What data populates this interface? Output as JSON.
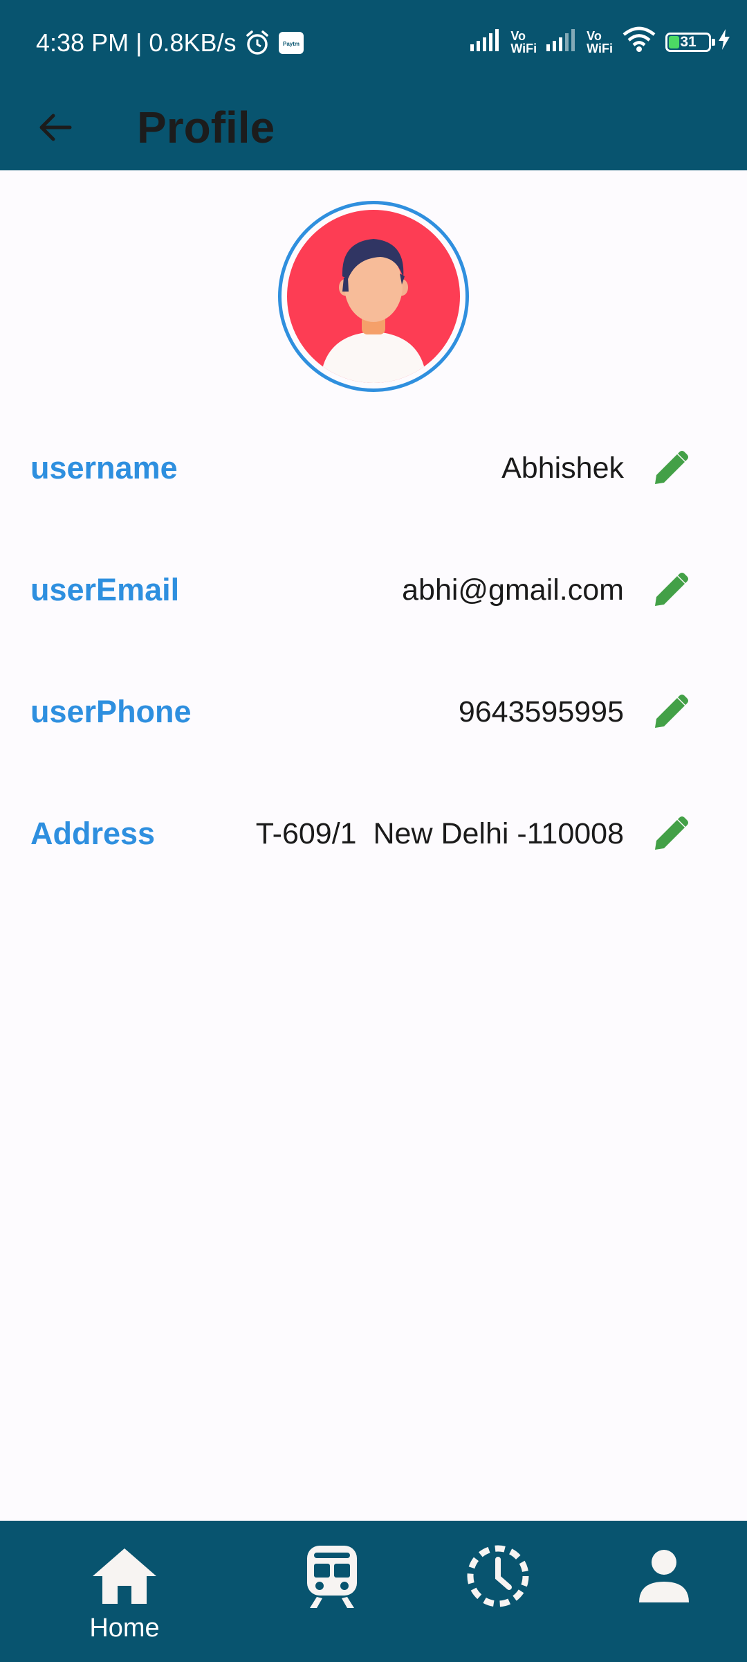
{
  "status_bar": {
    "time_speed": "4:38 PM | 0.8KB/s",
    "paytm_label": "Paytm",
    "vowifi_1_top": "Vo",
    "vowifi_1_bottom": "WiFi",
    "vowifi_2_top": "Vo",
    "vowifi_2_bottom": "WiFi",
    "battery_level": "31",
    "battery_fraction": 0.31
  },
  "header": {
    "title": "Profile",
    "back_icon": "arrow-back-icon",
    "background_color": "#08546f"
  },
  "avatar": {
    "icon": "user-avatar-illustration",
    "ring_color": "#2f8fde",
    "background_color": "#fd3d54"
  },
  "fields": [
    {
      "label": "username",
      "value": "Abhishek",
      "edit_icon": "pencil-icon"
    },
    {
      "label": "userEmail",
      "value": "abhi@gmail.com",
      "edit_icon": "pencil-icon"
    },
    {
      "label": "userPhone",
      "value": "9643595995",
      "edit_icon": "pencil-icon"
    },
    {
      "label": "Address",
      "value": "T-609/1  New Delhi -110008",
      "edit_icon": "pencil-icon"
    }
  ],
  "colors": {
    "label": "#2e8fdf",
    "edit_icon": "#43a047",
    "value_text": "#1a1a1a"
  },
  "bottom_nav": {
    "items": [
      {
        "label": "Home",
        "icon": "home-icon"
      },
      {
        "label": "",
        "icon": "train-icon"
      },
      {
        "label": "",
        "icon": "history-clock-icon"
      },
      {
        "label": "",
        "icon": "person-icon"
      }
    ]
  }
}
